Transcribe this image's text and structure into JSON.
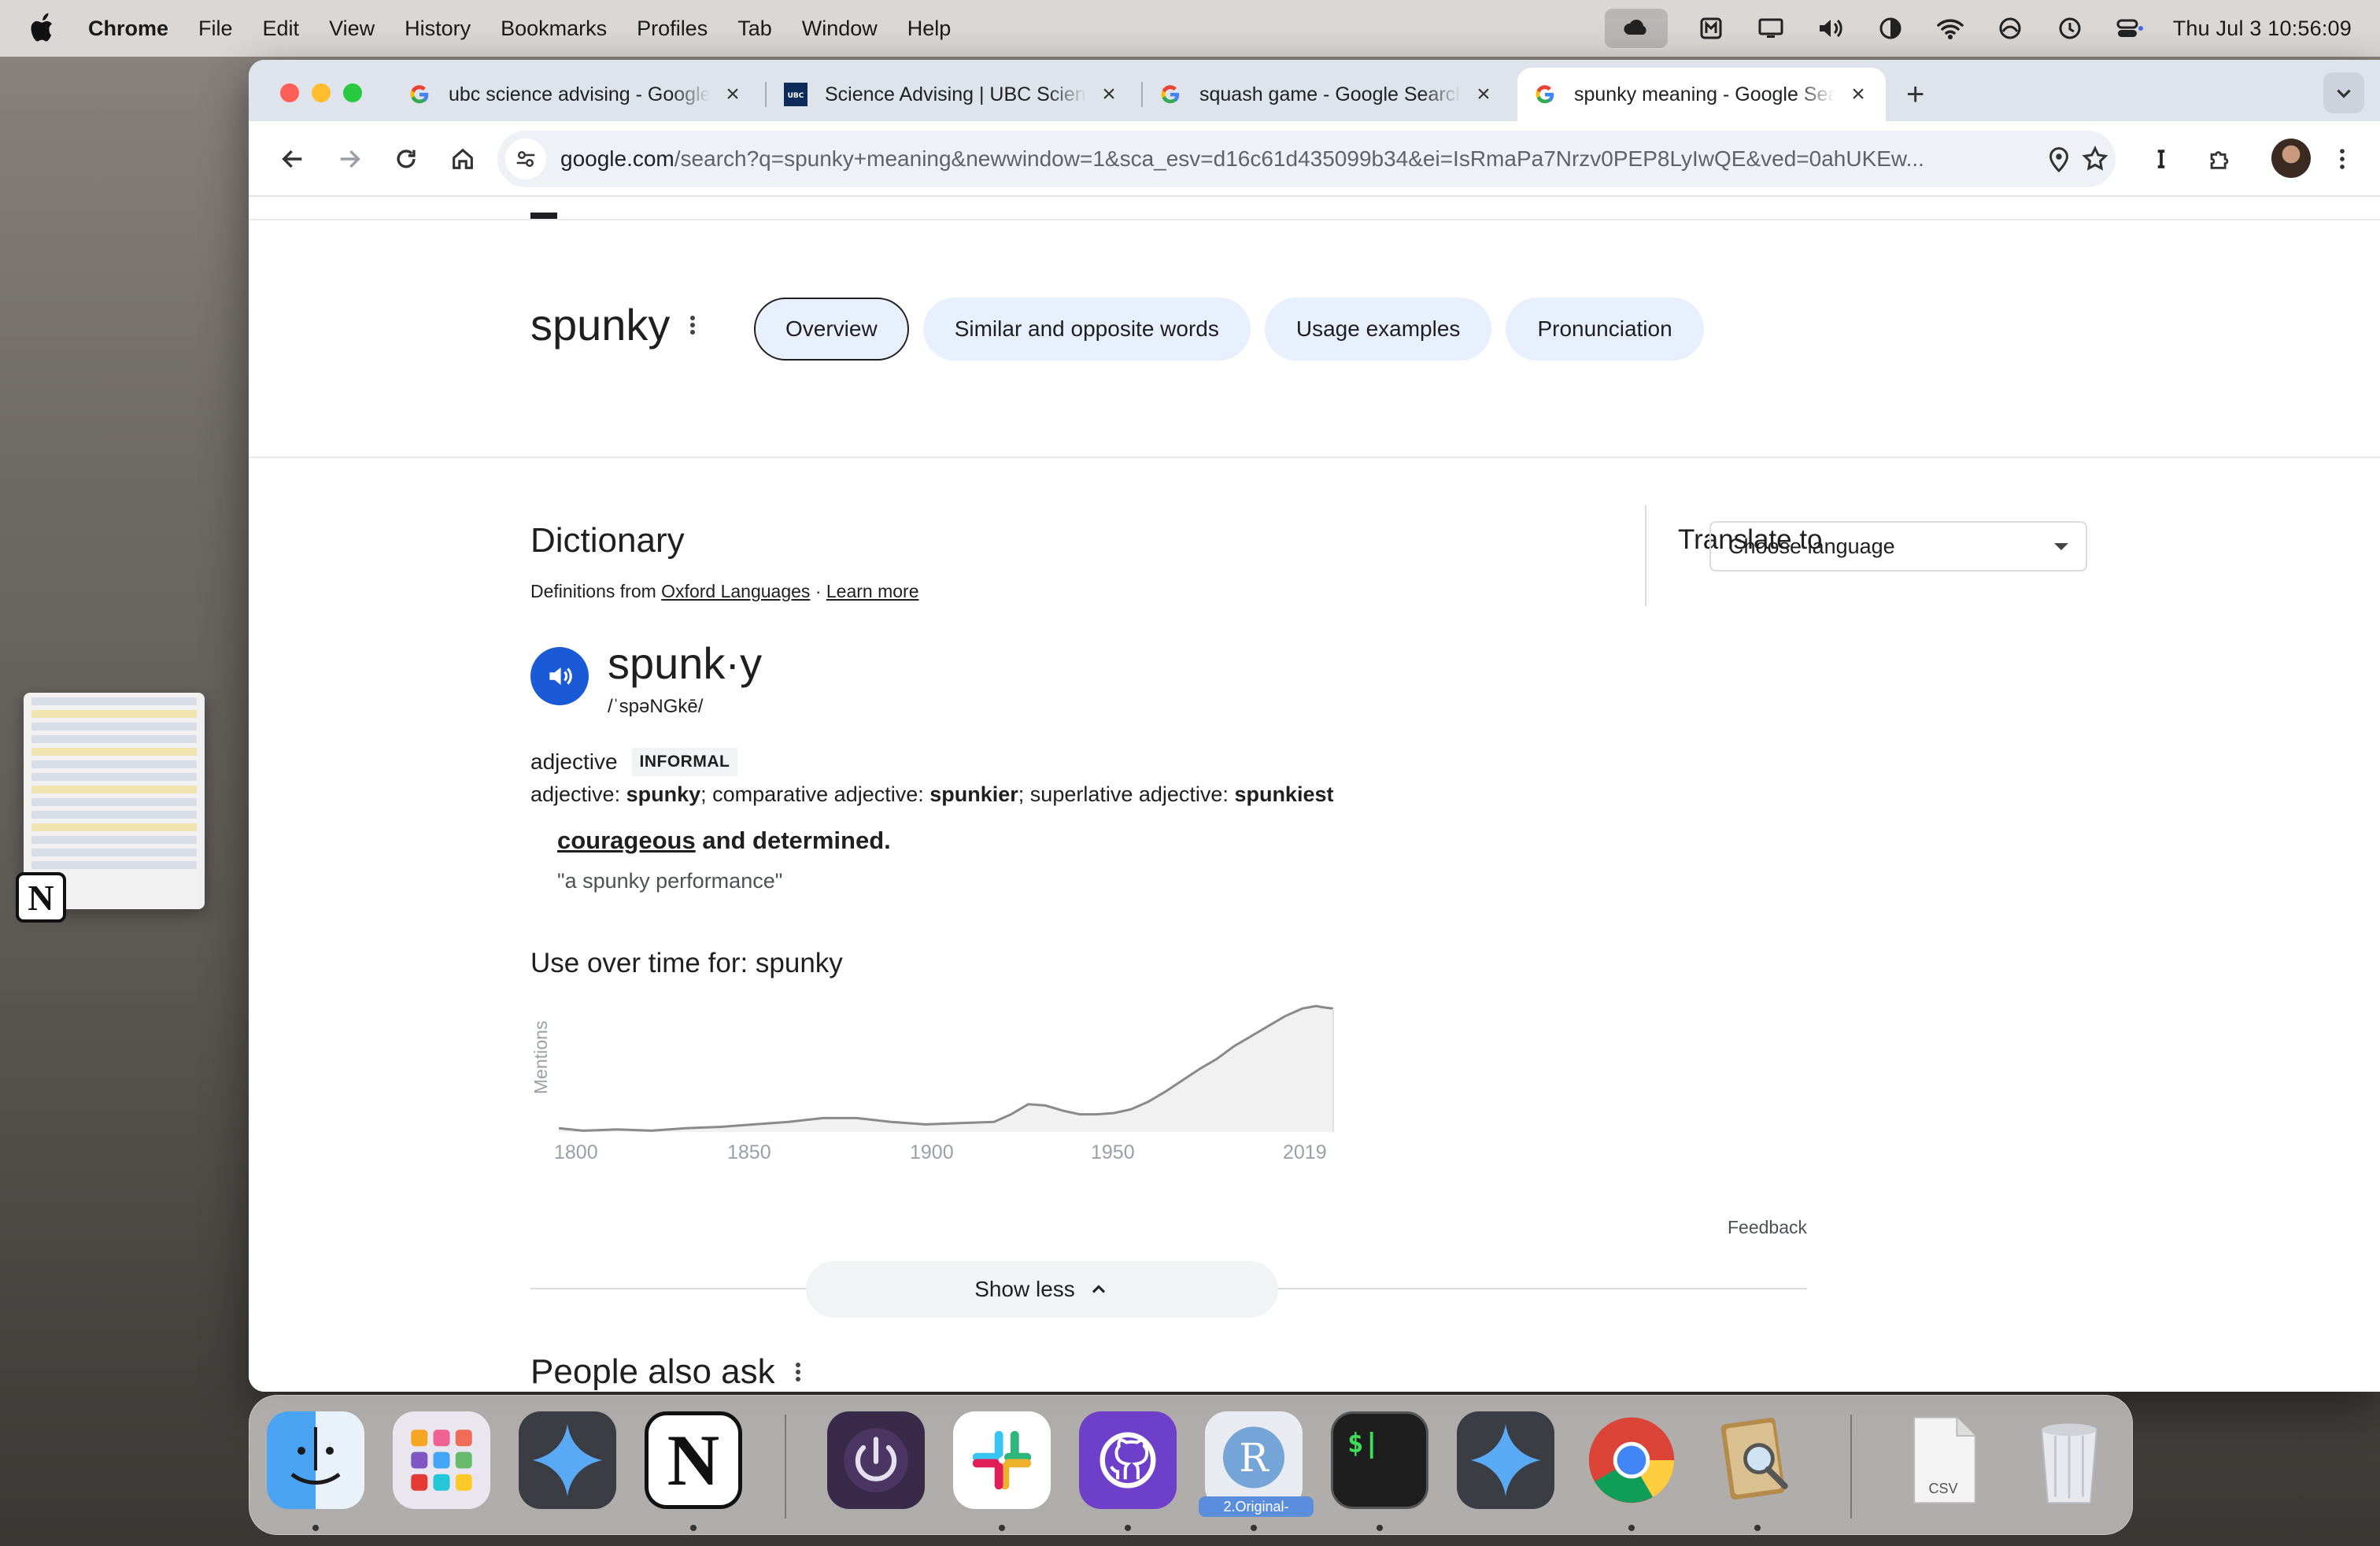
{
  "menubar": {
    "app_name": "Chrome",
    "items": [
      "File",
      "Edit",
      "View",
      "History",
      "Bookmarks",
      "Profiles",
      "Tab",
      "Window",
      "Help"
    ],
    "clock": "Thu Jul 3  10:56:09"
  },
  "tabs": [
    {
      "title": "ubc science advising - Google Search",
      "favicon": "google-icon"
    },
    {
      "title": "Science Advising | UBC Science",
      "favicon": "ubc-icon"
    },
    {
      "title": "squash game - Google Search",
      "favicon": "google-icon"
    },
    {
      "title": "spunky meaning - Google Search",
      "favicon": "google-icon",
      "active": true
    }
  ],
  "omnibox": {
    "host": "google.com",
    "path": "/search?q=spunky+meaning&newwindow=1&sca_esv=d16c61d435099b34&ei=IsRmaPa7Nrzv0PEP8LyIwQE&ved=0ahUKEw..."
  },
  "word_header": {
    "word": "spunky",
    "chips": [
      "Overview",
      "Similar and opposite words",
      "Usage examples",
      "Pronunciation"
    ],
    "selected_chip": "Overview"
  },
  "dictionary": {
    "title": "Dictionary",
    "source_prefix": "Definitions from",
    "source_name": "Oxford Languages",
    "separator": "·",
    "learn_more": "Learn more",
    "entry_word": "spunk·y",
    "phonetic": "/ˈspəNGkē/",
    "part_of_speech": "adjective",
    "register": "INFORMAL",
    "forms": {
      "label1": "adjective: ",
      "form1": "spunky",
      "label2": "; comparative adjective: ",
      "form2": "spunkier",
      "label3": "; superlative adjective: ",
      "form3": "spunkiest"
    },
    "definition_link": "courageous",
    "definition_rest": " and determined.",
    "example": "\"a spunky performance\""
  },
  "translate": {
    "label": "Translate to",
    "select_value": "Choose language"
  },
  "usage_chart": {
    "title": "Use over time for: spunky",
    "ylabel": "Mentions",
    "ticks": [
      "1800",
      "1850",
      "1900",
      "1950",
      "2019"
    ]
  },
  "chart_data": {
    "type": "area",
    "title": "Use over time for: spunky",
    "xlabel": "",
    "ylabel": "Mentions",
    "x": [
      1793,
      1800,
      1810,
      1820,
      1830,
      1840,
      1850,
      1860,
      1870,
      1880,
      1890,
      1900,
      1910,
      1920,
      1925,
      1930,
      1935,
      1940,
      1945,
      1950,
      1955,
      1960,
      1965,
      1970,
      1975,
      1980,
      1985,
      1990,
      1995,
      2000,
      2005,
      2010,
      2014,
      2016,
      2019
    ],
    "values": [
      3,
      1,
      2,
      1,
      3,
      4,
      6,
      8,
      11,
      11,
      8,
      6,
      7,
      8,
      14,
      22,
      21,
      17,
      14,
      14,
      15,
      18,
      24,
      32,
      41,
      50,
      58,
      68,
      76,
      84,
      92,
      98,
      100,
      99,
      98
    ],
    "xlim": [
      1793,
      2019
    ],
    "ylim": [
      0,
      100
    ],
    "grid": false,
    "legend": "none"
  },
  "footer": {
    "feedback": "Feedback",
    "show_less": "Show less",
    "people_also_ask": "People also ask"
  },
  "desktop": {
    "notion_letter": "N"
  },
  "dock": {
    "r_badge": "2.Original-",
    "csv_label": "CSV",
    "terminal_glyph": "$|",
    "r_letter": "R",
    "notion_letter": "N"
  }
}
